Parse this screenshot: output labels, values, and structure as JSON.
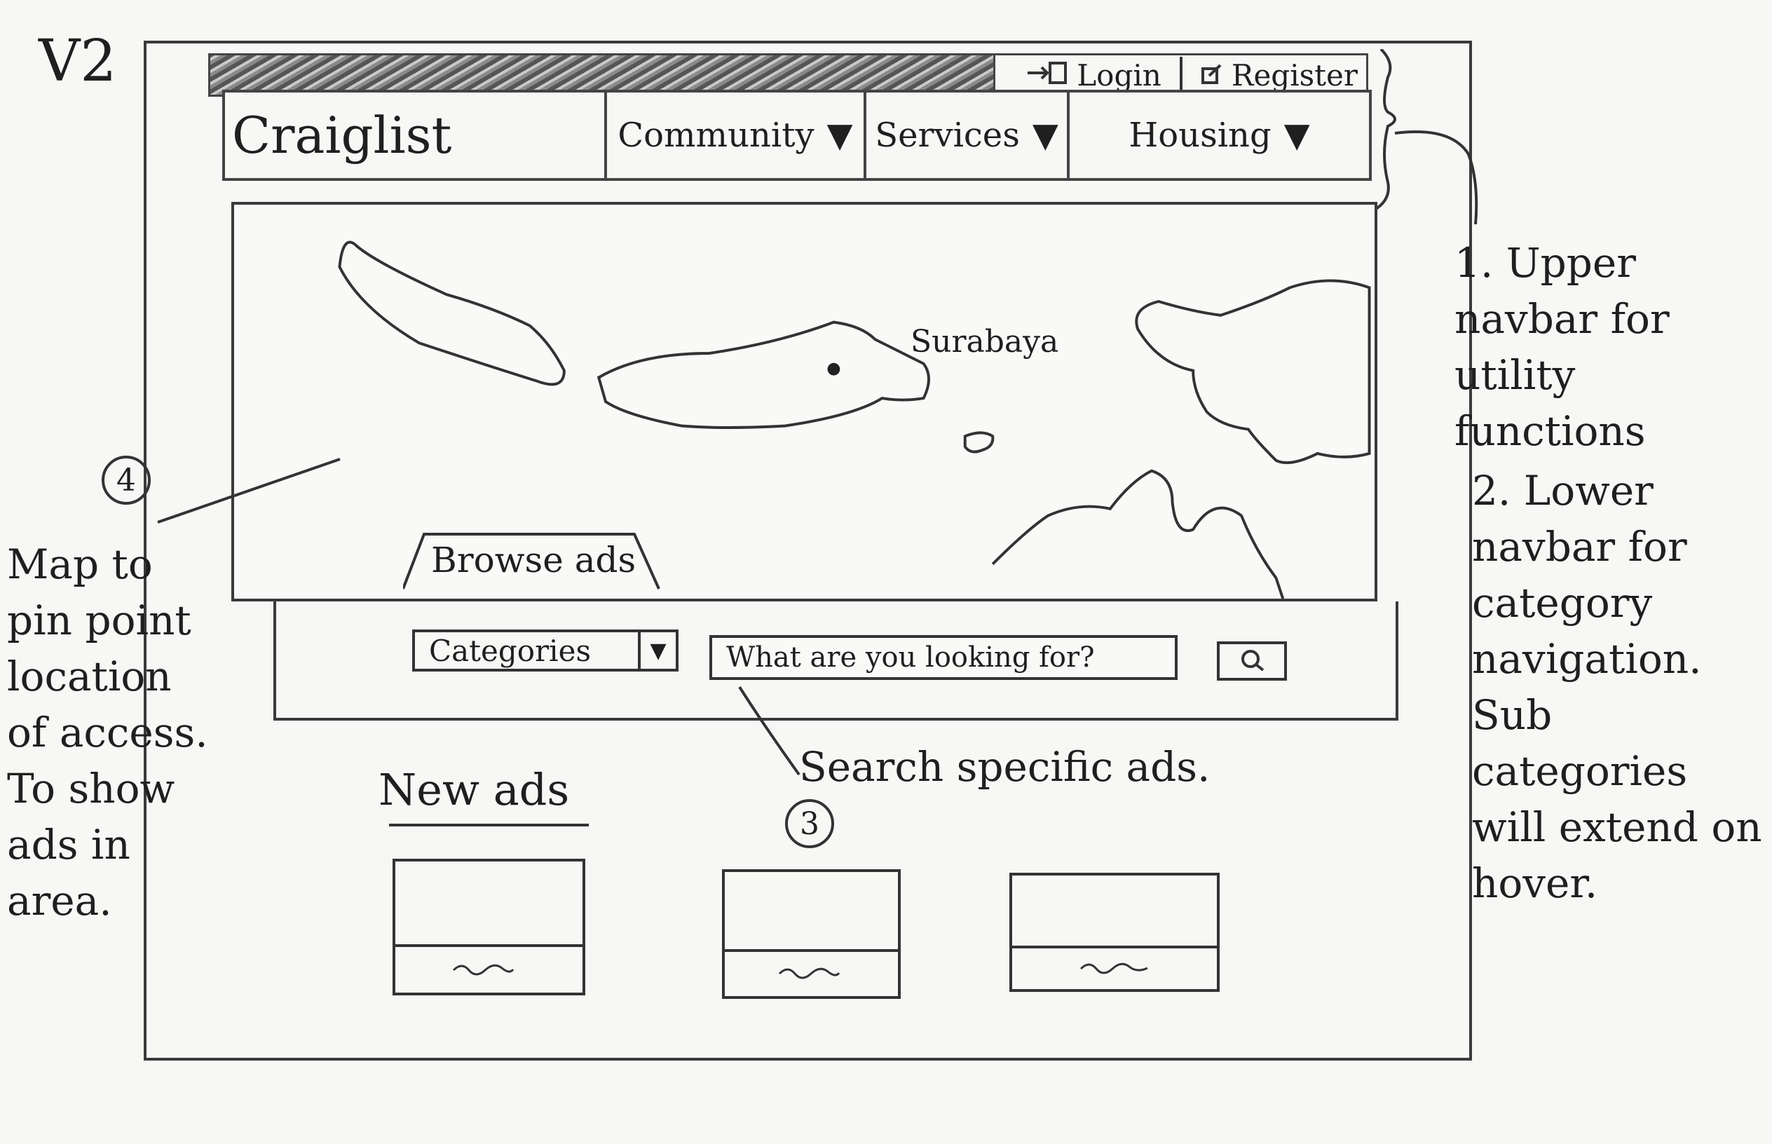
{
  "version_label": "V2",
  "header": {
    "login_label": "Login",
    "register_label": "Register",
    "brand": "Craiglist",
    "nav": [
      {
        "label": "Community",
        "icon": "caret-down-icon"
      },
      {
        "label": "Services",
        "icon": "caret-down-icon"
      },
      {
        "label": "Housing",
        "icon": "caret-down-icon"
      }
    ]
  },
  "map": {
    "city_label": "Surabaya",
    "tab_label": "Browse ads"
  },
  "search": {
    "category_label": "Categories",
    "placeholder": "What are you looking for?",
    "button_icon": "search-icon"
  },
  "new_ads": {
    "title": "New ads"
  },
  "annotations": {
    "note1": "1. Upper navbar for utility functions",
    "note2": "2. Lower navbar for category navigation. Sub categories will extend on hover.",
    "note3": "Search specific ads.",
    "note3_num": "3",
    "note4_num": "4",
    "note4": "Map to pin point location of access. To show ads in area."
  }
}
